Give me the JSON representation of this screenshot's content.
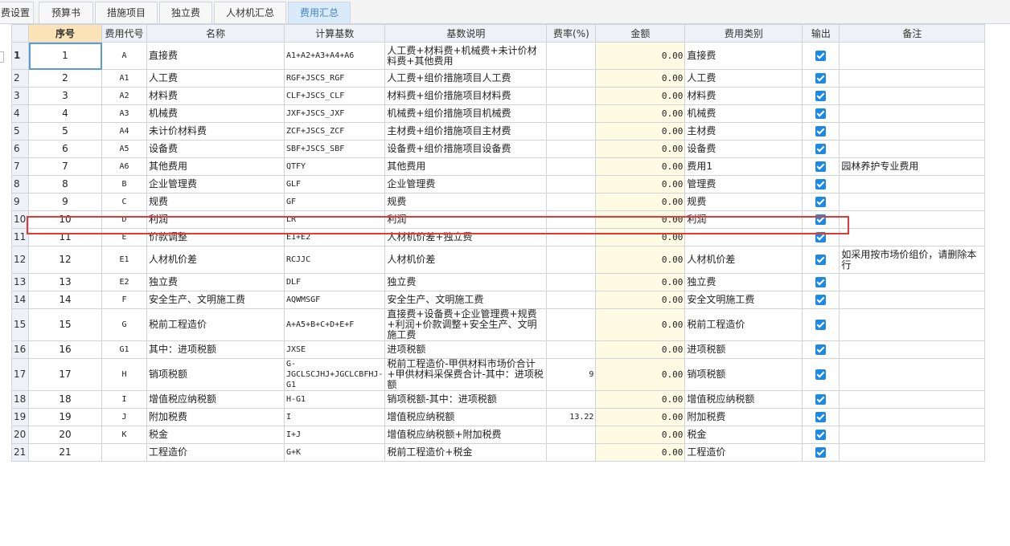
{
  "tabs": [
    {
      "label": "费设置",
      "active": false
    },
    {
      "label": "预算书",
      "active": false
    },
    {
      "label": "措施项目",
      "active": false
    },
    {
      "label": "独立费",
      "active": false
    },
    {
      "label": "人材机汇总",
      "active": false
    },
    {
      "label": "费用汇总",
      "active": true
    }
  ],
  "table": {
    "headers": [
      "序号",
      "费用代号",
      "名称",
      "计算基数",
      "基数说明",
      "费率(%)",
      "金额",
      "费用类别",
      "输出",
      "备注"
    ],
    "rows": [
      {
        "rownum": "1",
        "seq": "1",
        "code": "A",
        "name": "直接费",
        "base": "A1+A2+A3+A4+A6",
        "desc": "人工费+材料费+机械费+未计价材料费+其他费用",
        "rate": "",
        "amount": "0.00",
        "category": "直接费",
        "output": true,
        "remark": ""
      },
      {
        "rownum": "2",
        "seq": "2",
        "code": "A1",
        "name": "人工费",
        "base": "RGF+JSCS_RGF",
        "desc": "人工费+组价措施项目人工费",
        "rate": "",
        "amount": "0.00",
        "category": "人工费",
        "output": true,
        "remark": ""
      },
      {
        "rownum": "3",
        "seq": "3",
        "code": "A2",
        "name": "材料费",
        "base": "CLF+JSCS_CLF",
        "desc": "材料费+组价措施项目材料费",
        "rate": "",
        "amount": "0.00",
        "category": "材料费",
        "output": true,
        "remark": ""
      },
      {
        "rownum": "4",
        "seq": "4",
        "code": "A3",
        "name": "机械费",
        "base": "JXF+JSCS_JXF",
        "desc": "机械费+组价措施项目机械费",
        "rate": "",
        "amount": "0.00",
        "category": "机械费",
        "output": true,
        "remark": ""
      },
      {
        "rownum": "5",
        "seq": "5",
        "code": "A4",
        "name": "未计价材料费",
        "base": "ZCF+JSCS_ZCF",
        "desc": "主材费+组价措施项目主材费",
        "rate": "",
        "amount": "0.00",
        "category": "主材费",
        "output": true,
        "remark": ""
      },
      {
        "rownum": "6",
        "seq": "6",
        "code": "A5",
        "name": "设备费",
        "base": "SBF+JSCS_SBF",
        "desc": "设备费+组价措施项目设备费",
        "rate": "",
        "amount": "0.00",
        "category": "设备费",
        "output": true,
        "remark": ""
      },
      {
        "rownum": "7",
        "seq": "7",
        "code": "A6",
        "name": "其他费用",
        "base": "QTFY",
        "desc": "其他费用",
        "rate": "",
        "amount": "0.00",
        "category": "费用1",
        "output": true,
        "remark": "园林养护专业费用"
      },
      {
        "rownum": "8",
        "seq": "8",
        "code": "B",
        "name": "企业管理费",
        "base": "GLF",
        "desc": "企业管理费",
        "rate": "",
        "amount": "0.00",
        "category": "管理费",
        "output": true,
        "remark": ""
      },
      {
        "rownum": "9",
        "seq": "9",
        "code": "C",
        "name": "规费",
        "base": "GF",
        "desc": "规费",
        "rate": "",
        "amount": "0.00",
        "category": "规费",
        "output": true,
        "remark": ""
      },
      {
        "rownum": "10",
        "seq": "10",
        "code": "D",
        "name": "利润",
        "base": "LR",
        "desc": "利润",
        "rate": "",
        "amount": "0.00",
        "category": "利润",
        "output": true,
        "remark": ""
      },
      {
        "rownum": "11",
        "seq": "11",
        "code": "E",
        "name": "价款调整",
        "base": "E1+E2",
        "desc": "人材机价差+独立费",
        "rate": "",
        "amount": "0.00",
        "category": "",
        "output": true,
        "remark": ""
      },
      {
        "rownum": "12",
        "seq": "12",
        "code": "E1",
        "name": "人材机价差",
        "base": "RCJJC",
        "desc": "人材机价差",
        "rate": "",
        "amount": "0.00",
        "category": "人材机价差",
        "output": true,
        "remark": "如采用按市场价组价，请删除本行"
      },
      {
        "rownum": "13",
        "seq": "13",
        "code": "E2",
        "name": "独立费",
        "base": "DLF",
        "desc": "独立费",
        "rate": "",
        "amount": "0.00",
        "category": "独立费",
        "output": true,
        "remark": ""
      },
      {
        "rownum": "14",
        "seq": "14",
        "code": "F",
        "name": "安全生产、文明施工费",
        "base": "AQWMSGF",
        "desc": "安全生产、文明施工费",
        "rate": "",
        "amount": "0.00",
        "category": "安全文明施工费",
        "output": true,
        "remark": ""
      },
      {
        "rownum": "15",
        "seq": "15",
        "code": "G",
        "name": "税前工程造价",
        "base": "A+A5+B+C+D+E+F",
        "desc": "直接费+设备费+企业管理费+规费+利润+价款调整+安全生产、文明施工费",
        "rate": "",
        "amount": "0.00",
        "category": "税前工程造价",
        "output": true,
        "remark": ""
      },
      {
        "rownum": "16",
        "seq": "16",
        "code": "G1",
        "name": "其中：进项税额",
        "base": "JXSE",
        "desc": "进项税额",
        "rate": "",
        "amount": "0.00",
        "category": "进项税额",
        "output": true,
        "remark": ""
      },
      {
        "rownum": "17",
        "seq": "17",
        "code": "H",
        "name": "销项税额",
        "base": "G-JGCLSCJHJ+JGCLCBFHJ-G1",
        "desc": "税前工程造价-甲供材料市场价合计+甲供材料采保费合计-其中：进项税额",
        "rate": "9",
        "amount": "0.00",
        "category": "销项税额",
        "output": true,
        "remark": ""
      },
      {
        "rownum": "18",
        "seq": "18",
        "code": "I",
        "name": "增值税应纳税额",
        "base": "H-G1",
        "desc": "销项税额-其中：进项税额",
        "rate": "",
        "amount": "0.00",
        "category": "增值税应纳税额",
        "output": true,
        "remark": ""
      },
      {
        "rownum": "19",
        "seq": "19",
        "code": "J",
        "name": "附加税费",
        "base": "I",
        "desc": "增值税应纳税额",
        "rate": "13.22",
        "amount": "0.00",
        "category": "附加税费",
        "output": true,
        "remark": ""
      },
      {
        "rownum": "20",
        "seq": "20",
        "code": "K",
        "name": "税金",
        "base": "I+J",
        "desc": "增值税应纳税额+附加税费",
        "rate": "",
        "amount": "0.00",
        "category": "税金",
        "output": true,
        "remark": ""
      },
      {
        "rownum": "21",
        "seq": "21",
        "code": "",
        "name": "工程造价",
        "base": "G+K",
        "desc": "税前工程造价+税金",
        "rate": "",
        "amount": "0.00",
        "category": "工程造价",
        "output": true,
        "remark": ""
      }
    ]
  },
  "colors": {
    "active_tab": "#d9ebfa",
    "header_highlight": "#fbe3b7",
    "amount_column": "#fdfbe4",
    "checkbox": "#1e88e5",
    "highlight_box": "#e53935"
  }
}
